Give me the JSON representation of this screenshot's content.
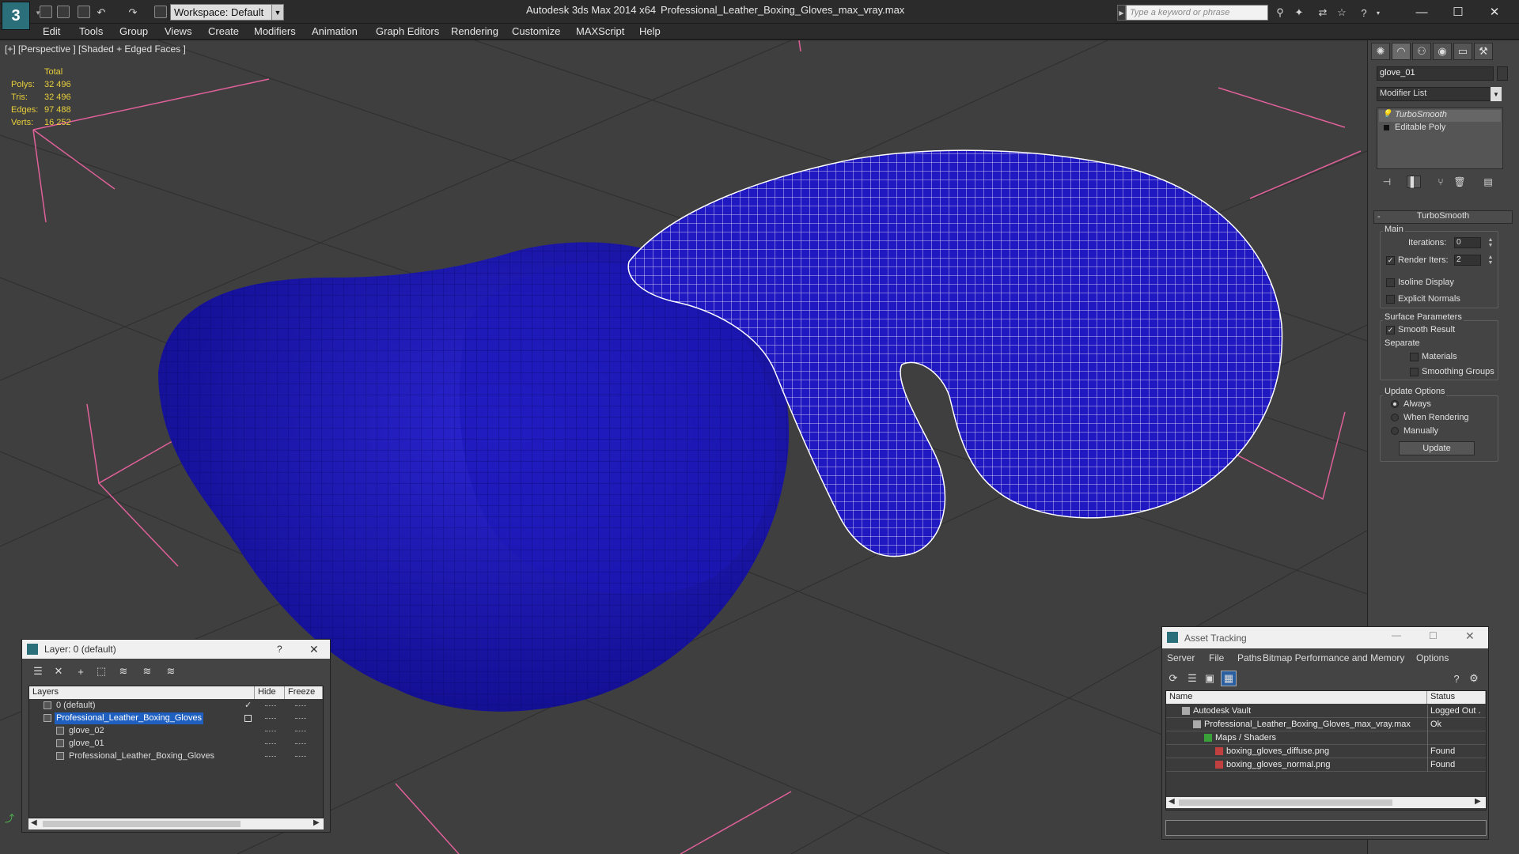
{
  "titlebar": {
    "workspace": "Workspace: Default",
    "app_title": "Autodesk 3ds Max  2014 x64",
    "file_title": "Professional_Leather_Boxing_Gloves_max_vray.max",
    "search_placeholder": "Type a keyword or phrase"
  },
  "menu": [
    "Edit",
    "Tools",
    "Group",
    "Views",
    "Create",
    "Modifiers",
    "Animation",
    "Graph Editors",
    "Rendering",
    "Customize",
    "MAXScript",
    "Help"
  ],
  "viewport": {
    "label": "[+] [Perspective ] [Shaded + Edged Faces ]",
    "stats": {
      "header": "Total",
      "rows": [
        {
          "label": "Polys:",
          "value": "32 496"
        },
        {
          "label": "Tris:",
          "value": "32 496"
        },
        {
          "label": "Edges:",
          "value": "97 488"
        },
        {
          "label": "Verts:",
          "value": "16 252"
        }
      ]
    },
    "mesh_color": "#1a14b4",
    "wire_color": "#ffffff"
  },
  "command_panel": {
    "object_name": "glove_01",
    "modifier_list": "Modifier List",
    "stack": [
      "TurboSmooth",
      "Editable Poly"
    ],
    "rollout_title": "TurboSmooth",
    "main_label": "Main",
    "iterations_label": "Iterations:",
    "iterations_value": "0",
    "render_iters_label": "Render Iters:",
    "render_iters_value": "2",
    "isoline_label": "Isoline Display",
    "explicit_normals_label": "Explicit Normals",
    "surface_params_label": "Surface Parameters",
    "smooth_result_label": "Smooth Result",
    "separate_label": "Separate",
    "materials_label": "Materials",
    "smoothing_groups_label": "Smoothing Groups",
    "update_options_label": "Update Options",
    "always_label": "Always",
    "when_rendering_label": "When Rendering",
    "manually_label": "Manually",
    "update_button": "Update"
  },
  "layer_dialog": {
    "title": "Layer: 0 (default)",
    "help": "?",
    "columns": [
      "Layers",
      "Hide",
      "Freeze"
    ],
    "rows": [
      {
        "name": "0 (default)",
        "indent": 1,
        "selected": false
      },
      {
        "name": "Professional_Leather_Boxing_Gloves",
        "indent": 1,
        "selected": true
      },
      {
        "name": "glove_02",
        "indent": 2,
        "selected": false
      },
      {
        "name": "glove_01",
        "indent": 2,
        "selected": false
      },
      {
        "name": "Professional_Leather_Boxing_Gloves",
        "indent": 2,
        "selected": false
      }
    ]
  },
  "asset_dialog": {
    "title": "Asset Tracking",
    "menu": [
      "Server",
      "File",
      "Paths",
      "Bitmap Performance and Memory",
      "Options"
    ],
    "columns": [
      "Name",
      "Status"
    ],
    "rows": [
      {
        "name": "Autodesk Vault",
        "status": "Logged Out ."
      },
      {
        "name": "Professional_Leather_Boxing_Gloves_max_vray.max",
        "status": "Ok"
      },
      {
        "name": "Maps / Shaders",
        "status": ""
      },
      {
        "name": "boxing_gloves_diffuse.png",
        "status": "Found"
      },
      {
        "name": "boxing_gloves_normal.png",
        "status": "Found"
      }
    ]
  }
}
